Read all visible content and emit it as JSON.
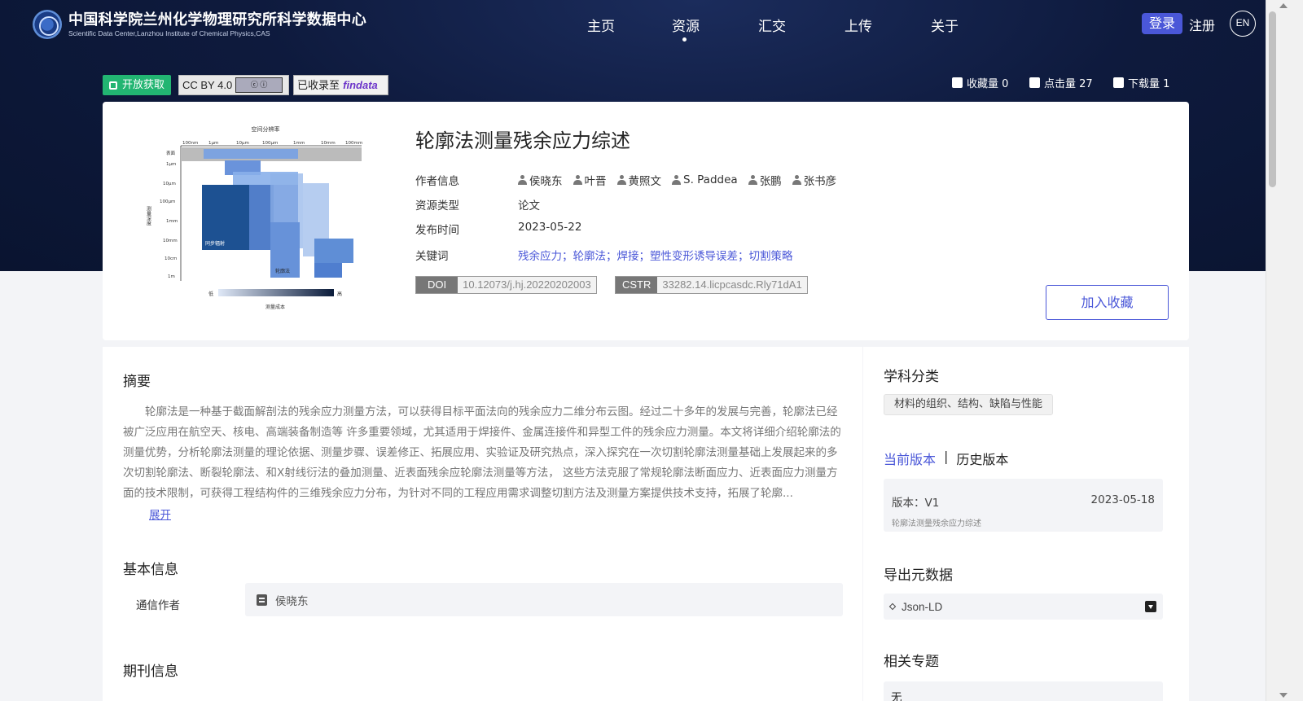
{
  "header": {
    "site_title_cn": "中国科学院兰州化学物理研究所科学数据中心",
    "site_title_en": "Scientific Data Center,Lanzhou Institute of Chemical Physics,CAS",
    "nav": [
      "主页",
      "资源",
      "汇交",
      "上传",
      "关于"
    ],
    "active_nav": "资源",
    "login": "登录",
    "register": "注册",
    "lang": "EN"
  },
  "badges": {
    "open_access": "开放获取",
    "license": "CC BY 4.0",
    "indexed_prefix": "已收录至",
    "indexed_brand": "findata"
  },
  "stats": {
    "favorites": "收藏量 0",
    "clicks": "点击量 27",
    "downloads": "下载量 1"
  },
  "paper": {
    "title": "轮廓法测量残余应力综述",
    "author_label": "作者信息",
    "authors": [
      "侯晓东",
      "叶晋",
      "黄照文",
      "S. Paddea",
      "张鹏",
      "张书彦"
    ],
    "type_label": "资源类型",
    "type_value": "论文",
    "date_label": "发布时间",
    "date_value": "2023-05-22",
    "keywords_label": "关键词",
    "keywords": "残余应力；轮廓法；焊接；塑性变形诱导误差；切割策略",
    "doi_label": "DOI",
    "doi_value": "10.12073/j.hj.20220202003",
    "cstr_label": "CSTR",
    "cstr_value": "33282.14.licpcasdc.Rly71dA1",
    "add_fav": "加入收藏"
  },
  "thumbnail": {
    "title": "空间分辨率",
    "top_ticks": [
      "100nm",
      "1μm",
      "10μm",
      "100μm",
      "1mm",
      "10mm",
      "100mm"
    ],
    "left_ticks": [
      "表面",
      "1μm",
      "10μm",
      "100μm",
      "1mm",
      "10mm",
      "10cm",
      "1m"
    ],
    "ylabel": "测量深度",
    "low": "低",
    "high": "高",
    "xlabel": "测量成本",
    "method_label_1": "同步辐射",
    "method_label_2": "轮廓法"
  },
  "abstract": {
    "title": "摘要",
    "text": "轮廓法是一种基于截面解剖法的残余应力测量方法，可以获得目标平面法向的残余应力二维分布云图。经过二十多年的发展与完善，轮廓法已经被广泛应用在航空天、核电、高端装备制造等 许多重要领域，尤其适用于焊接件、金属连接件和异型工件的残余应力测量。本文将详细介绍轮廓法的测量优势，分析轮廓法测量的理论依据、测量步骤、误差修正、拓展应用、实验证及研究热点，深入探究在一次切割轮廓法测量基础上发展起来的多次切割轮廓法、断裂轮廓法、和X射线衍法的叠加测量、近表面残余应轮廓法测量等方法， 这些方法克服了常规轮廓法断面应力、近表面应力测量方面的技术限制，可获得工程结构件的三维残余应力分布，为针对不同的工程应用需求调整切割方法及测量方案提供技术支持，拓展了轮廓...",
    "expand": "展开"
  },
  "basic_info": {
    "title": "基本信息",
    "corr_label": "通信作者",
    "corr_value": "侯晓东"
  },
  "journal": {
    "title": "期刊信息"
  },
  "sidebar": {
    "subject_title": "学科分类",
    "subject_tag": "材料的组织、结构、缺陷与性能",
    "current_version": "当前版本",
    "separator": "|",
    "history_version": "历史版本",
    "version_num": "版本：V1",
    "version_date": "2023-05-18",
    "version_desc": "轮廓法测量残余应力综述",
    "export_title": "导出元数据",
    "export_value": "Json-LD",
    "topics_title": "相关专题",
    "topics_value": "无"
  },
  "colors": {
    "accent": "#4a57d8",
    "open_badge": "#22b572",
    "header_bg": "#0e1a3d"
  }
}
